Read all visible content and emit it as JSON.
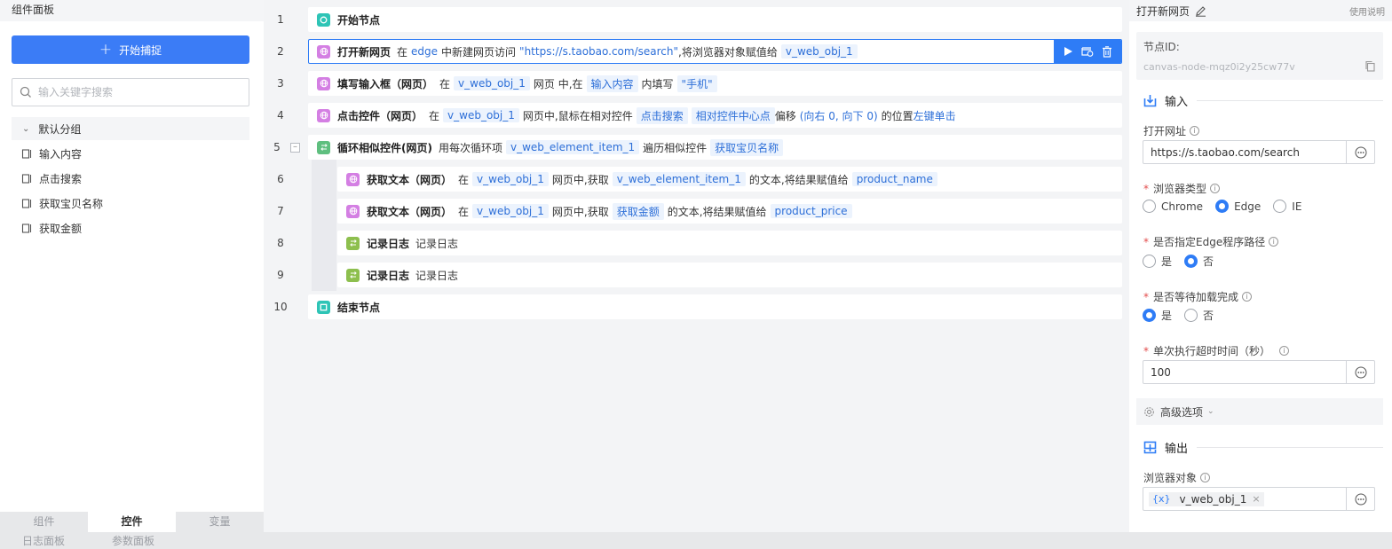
{
  "left_panel": {
    "title": "组件面板",
    "capture_button": "开始捕捉",
    "search_placeholder": "输入关键字搜索",
    "group_name": "默认分组",
    "items": [
      "输入内容",
      "点击搜索",
      "获取宝贝名称",
      "获取金额"
    ],
    "bottom_tabs": [
      "组件",
      "控件",
      "变量"
    ],
    "active_tab": "控件"
  },
  "footer": {
    "tabs": [
      "日志面板",
      "参数面板"
    ]
  },
  "flow": {
    "rows": [
      {
        "num": "1",
        "title": "开始节点"
      },
      {
        "num": "2",
        "title": "打开新网页",
        "parts": [
          "在",
          "edge",
          "中新建网页访问",
          "\"https://s.taobao.com/search\"",
          ",将浏览器对象赋值给",
          "v_web_obj_1"
        ]
      },
      {
        "num": "3",
        "title": "填写输入框（网页）",
        "parts": [
          "在",
          "v_web_obj_1",
          "网页 中,在",
          "输入内容",
          "内填写",
          "\"手机\""
        ]
      },
      {
        "num": "4",
        "title": "点击控件（网页）",
        "parts": [
          "在",
          "v_web_obj_1",
          "网页中,鼠标在相对控件",
          "点击搜索",
          "相对控件中心点",
          "偏移",
          "(向右 0, 向下 0)",
          "的位置",
          "左键单击"
        ]
      },
      {
        "num": "5",
        "title": "循环相似控件(网页)",
        "parts": [
          "用每次循环项",
          "v_web_element_item_1",
          "遍历相似控件",
          "获取宝贝名称"
        ]
      },
      {
        "num": "6",
        "title": "获取文本（网页）",
        "parts": [
          "在",
          "v_web_obj_1",
          "网页中,获取",
          "v_web_element_item_1",
          "的文本,将结果赋值给",
          "product_name"
        ]
      },
      {
        "num": "7",
        "title": "获取文本（网页）",
        "parts": [
          "在",
          "v_web_obj_1",
          "网页中,获取",
          "获取金额",
          "的文本,将结果赋值给",
          "product_price"
        ]
      },
      {
        "num": "8",
        "title": "记录日志",
        "parts": [
          "记录日志"
        ]
      },
      {
        "num": "9",
        "title": "记录日志",
        "parts": [
          "记录日志"
        ]
      },
      {
        "num": "10",
        "title": "结束节点"
      }
    ]
  },
  "right_panel": {
    "title": "打开新网页",
    "help": "使用说明",
    "node_id_label": "节点ID:",
    "node_id": "canvas-node-mqz0i2y25cw77v",
    "input_section": "输入",
    "url_label": "打开网址",
    "url_value": "https://s.taobao.com/search",
    "browser_label": "浏览器类型",
    "browser_options": [
      "Chrome",
      "Edge",
      "IE"
    ],
    "browser_selected": "Edge",
    "edge_path_label": "是否指定Edge程序路径",
    "edge_path_options": [
      "是",
      "否"
    ],
    "edge_path_selected": "否",
    "wait_label": "是否等待加载完成",
    "wait_options": [
      "是",
      "否"
    ],
    "wait_selected": "是",
    "timeout_label": "单次执行超时时间（秒）",
    "timeout_value": "100",
    "advanced_label": "高级选项",
    "output_section": "输出",
    "browser_obj_label": "浏览器对象",
    "browser_obj_brace": "{x}",
    "browser_obj_value": "v_web_obj_1",
    "tag_remove": "×"
  },
  "colors": {
    "primary": "#2e7cf6",
    "chip_bg": "#ecf3fd",
    "chip_text": "#2d6fd8",
    "required": "#e34d4d"
  },
  "icons": [
    "search-icon",
    "plus-icon",
    "chevron-down-icon",
    "component-icon",
    "play-icon",
    "debug-icon",
    "delete-icon",
    "edit-icon",
    "copy-icon",
    "input-icon",
    "output-icon",
    "gear-icon",
    "more-icon"
  ]
}
